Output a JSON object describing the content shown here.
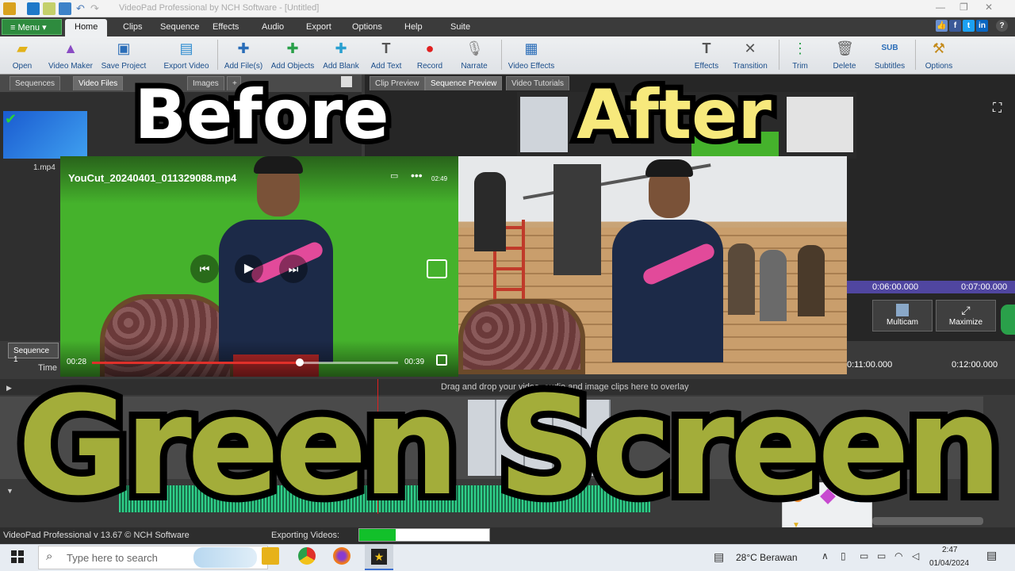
{
  "titlebar": {
    "title": "VideoPad Professional by NCH Software - [Untitled]"
  },
  "menu": {
    "menu_button": "Menu",
    "tabs": [
      "Home",
      "Clips",
      "Sequence",
      "Effects",
      "Audio",
      "Export",
      "Options",
      "Help",
      "Suite"
    ]
  },
  "ribbon": {
    "buttons": [
      "Open",
      "Video Maker",
      "Save Project",
      "Export Video",
      "Add File(s)",
      "Add Objects",
      "Add Blank",
      "Add Text",
      "Record",
      "Narrate",
      "Video Effects",
      "Effects",
      "Transition",
      "Trim",
      "Delete",
      "Subtitles",
      "Options"
    ]
  },
  "bins": {
    "tabs": [
      "Sequences",
      "Video Files",
      "Images",
      "+"
    ],
    "file_name": "1.mp4"
  },
  "preview": {
    "tabs": [
      "Clip Preview",
      "Sequence Preview",
      "Video Tutorials"
    ],
    "ruler": [
      "0:06:00.000",
      "0:07:00.000"
    ],
    "multicam": "Multicam",
    "maximize": "Maximize"
  },
  "overlay": {
    "before": "Before",
    "after": "After",
    "headline": "Green Screen"
  },
  "before_video": {
    "file": "YouCut_20240401_011329088.mp4",
    "time_current": "00:28",
    "time_total": "00:39",
    "battery": "02:49",
    "progress": 0.68
  },
  "timeline": {
    "sequence_tab": "Sequence 1",
    "time_label": "Time",
    "ruler": [
      "0:11:00.000",
      "0:12:00.000"
    ],
    "hint": "Drag and drop your video, audio and image clips here to overlay"
  },
  "status": {
    "app": "VideoPad Professional v 13.67 © NCH Software",
    "exporting": "Exporting Videos:",
    "export_progress": 0.28
  },
  "taskbar": {
    "search_placeholder": "Type here to search",
    "weather": "28°C  Berawan",
    "time": "2:47",
    "date": "01/04/2024"
  },
  "colors": {
    "headline": "#a3ad3a",
    "after": "#f7e97c",
    "green_screen": "#45b22c",
    "accent": "#2e8b3e"
  }
}
